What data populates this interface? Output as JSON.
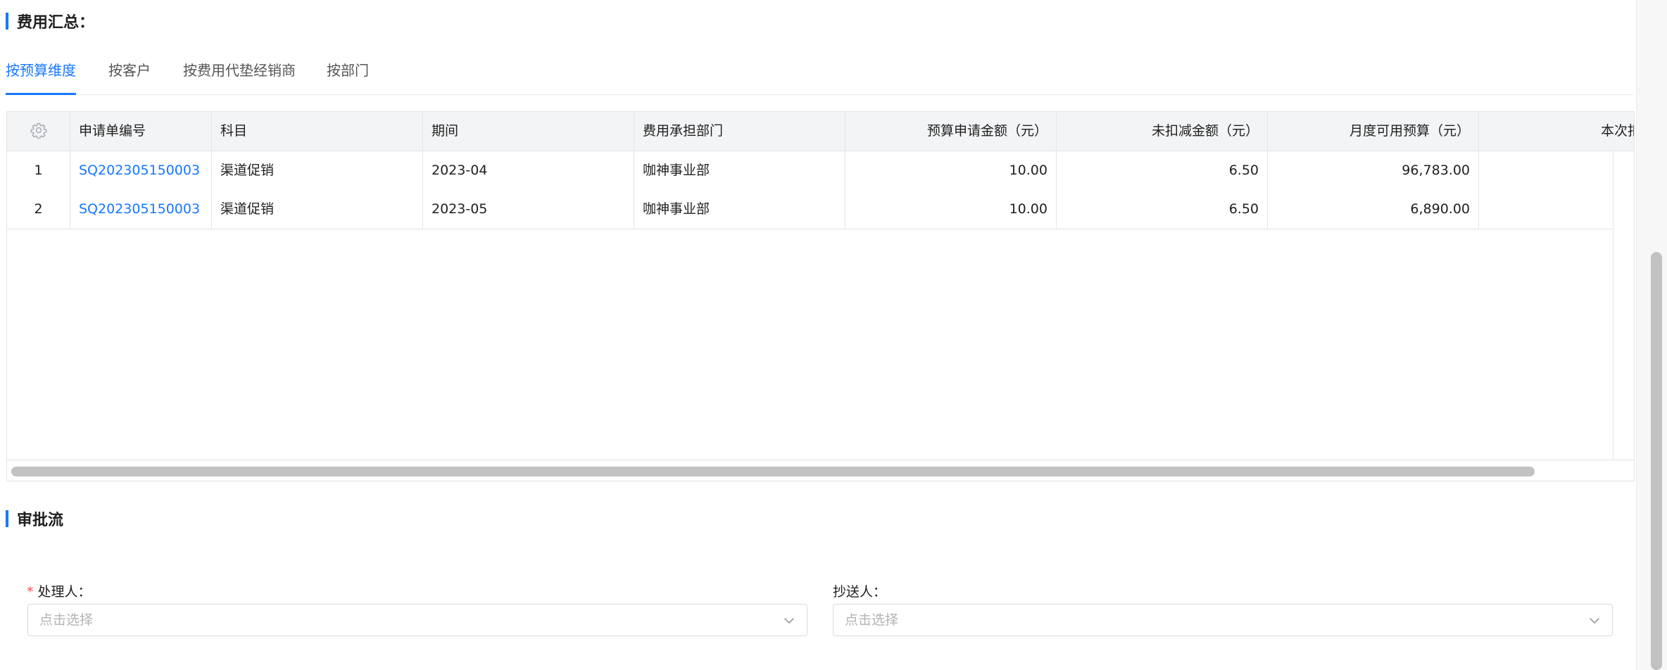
{
  "summary": {
    "title": "费用汇总："
  },
  "tabs": [
    {
      "label": "按预算维度",
      "active": true
    },
    {
      "label": "按客户",
      "active": false
    },
    {
      "label": "按费用代垫经销商",
      "active": false
    },
    {
      "label": "按部门",
      "active": false
    }
  ],
  "table": {
    "settings_icon": "gear-icon",
    "columns": [
      "申请单编号",
      "科目",
      "期间",
      "费用承担部门",
      "预算申请金额（元）",
      "未扣减金额（元）",
      "月度可用预算（元）",
      "本次扣减金额"
    ],
    "rows": [
      {
        "index": "1",
        "request_no": "SQ202305150003",
        "subject": "渠道促销",
        "period": "2023-04",
        "department": "咖神事业部",
        "apply_amount": "10.00",
        "undeducted_amount": "6.50",
        "monthly_budget": "96,783.00",
        "deduct_amount": ""
      },
      {
        "index": "2",
        "request_no": "SQ202305150003",
        "subject": "渠道促销",
        "period": "2023-05",
        "department": "咖神事业部",
        "apply_amount": "10.00",
        "undeducted_amount": "6.50",
        "monthly_budget": "6,890.00",
        "deduct_amount": ""
      }
    ]
  },
  "approval": {
    "title": "审批流",
    "handler": {
      "required_mark": "*",
      "label": "处理人：",
      "placeholder": "点击选择"
    },
    "cc": {
      "label": "抄送人：",
      "placeholder": "点击选择"
    }
  },
  "colors": {
    "accent": "#1677ff",
    "required": "#ff4d4f",
    "header_bg": "#f3f4f6",
    "border": "#e4e4e4",
    "placeholder": "#b3b3b3"
  }
}
